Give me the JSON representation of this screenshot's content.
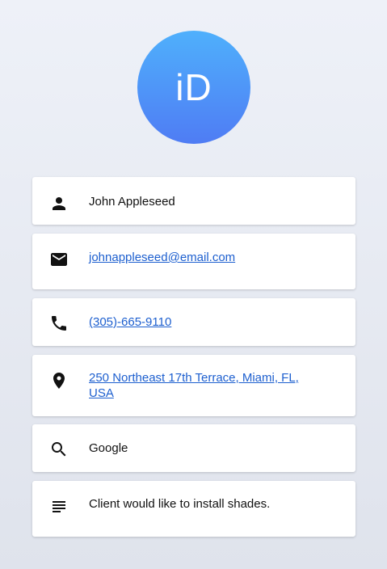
{
  "avatar": {
    "initials": "iD",
    "gradient_top": "#4fb0fc",
    "gradient_bottom": "#4f7cf4"
  },
  "contact": {
    "name": "John Appleseed",
    "email": "johnappleseed@email.com",
    "phone": "(305)-665-9110",
    "address": "250 Northeast 17th Terrace, Miami, FL, USA",
    "search": "Google",
    "note": "Client would like to install shades."
  },
  "icons": {
    "name": "person-icon",
    "email": "mail-icon",
    "phone": "phone-icon",
    "address": "location-pin-icon",
    "search": "search-icon",
    "note": "notes-icon"
  },
  "colors": {
    "link": "#1d5fcf",
    "text": "#111111",
    "card": "#ffffff"
  }
}
